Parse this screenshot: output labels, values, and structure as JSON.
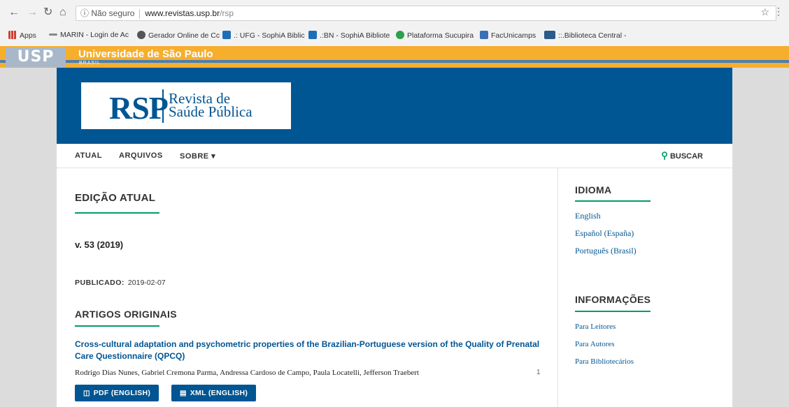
{
  "browser": {
    "url_info": "ⓘ Não seguro",
    "url_host": "www.revistas.usp.br",
    "url_path": "/rsp",
    "bookmarks": [
      {
        "label": "Apps",
        "color": "#d23f31"
      },
      {
        "label": "MARIN - Login de Ac",
        "color": "#888888"
      },
      {
        "label": "Gerador Online de Cc",
        "color": "#555555"
      },
      {
        "label": ".: UFG - SophiA Biblic",
        "color": "#1e6fb8"
      },
      {
        "label": ".:BN - SophiA Bibliote",
        "color": "#1e6fb8"
      },
      {
        "label": "Plataforma Sucupira",
        "color": "#2aa14b"
      },
      {
        "label": "FacUnicamps",
        "color": "#3b6fb5"
      },
      {
        "label": "::.Biblioteca Central -",
        "color": "#2c5a8c"
      }
    ]
  },
  "usp": {
    "logo": "USP",
    "name": "Universidade de São Paulo",
    "country": "BRASIL"
  },
  "journal": {
    "abbr": "RSP",
    "name_line1": "Revista de",
    "name_line2": "Saúde Pública"
  },
  "nav": {
    "items": [
      "ATUAL",
      "ARQUIVOS",
      "SOBRE ▾"
    ],
    "search": "BUSCAR"
  },
  "main": {
    "issue_heading": "EDIÇÃO ATUAL",
    "volume": "v. 53 (2019)",
    "published_label": "PUBLICADO:",
    "published_date": "2019-02-07",
    "section_heading": "ARTIGOS ORIGINAIS",
    "article": {
      "title": "Cross-cultural adaptation and psychometric properties of the Brazilian-Portuguese version of the Quality of Prenatal Care Questionnaire (QPCQ)",
      "authors": "Rodrigo Dias Nunes, Gabriel Cremona Parma, Andressa Cardoso de Campo, Paula Locatelli, Jefferson Traebert",
      "pages": "1",
      "pdf_label": "PDF (ENGLISH)",
      "xml_label": "XML (ENGLISH)"
    }
  },
  "sidebar": {
    "language_title": "IDIOMA",
    "languages": [
      "English",
      "Español (España)",
      "Português (Brasil)"
    ],
    "info_title": "INFORMAÇÕES",
    "info_links": [
      "Para Leitores",
      "Para Autores",
      "Para Bibliotecários"
    ]
  },
  "colors": {
    "primary": "#005593",
    "accent": "#009b6b",
    "usp_orange": "#f6ae2d"
  }
}
